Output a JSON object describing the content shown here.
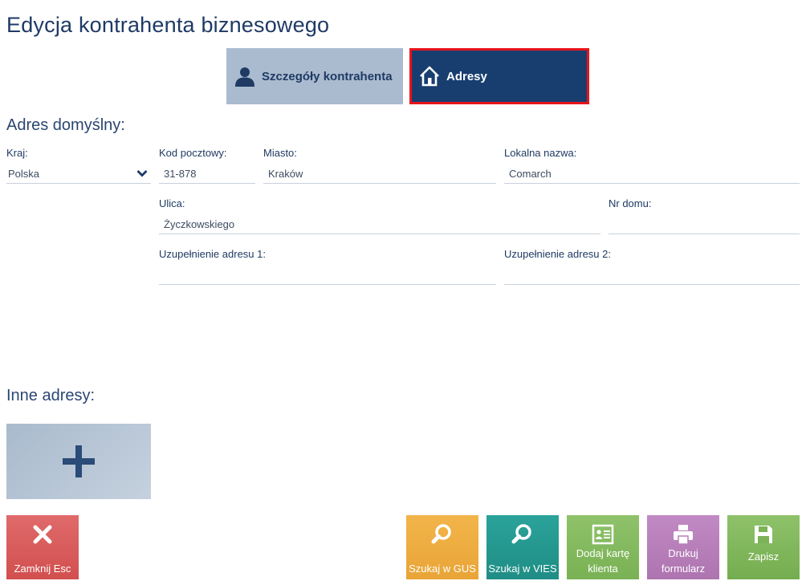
{
  "page": {
    "title": "Edycja kontrahenta biznesowego"
  },
  "tabs": [
    {
      "label": "Szczegóły kontrahenta",
      "icon": "user-icon",
      "active": false
    },
    {
      "label": "Adresy",
      "icon": "home-icon",
      "active": true
    }
  ],
  "default_address": {
    "heading": "Adres domyślny:",
    "country": {
      "label": "Kraj:",
      "value": "Polska"
    },
    "postal_code": {
      "label": "Kod pocztowy:",
      "value": "31-878"
    },
    "city": {
      "label": "Miasto:",
      "value": "Kraków"
    },
    "local_name": {
      "label": "Lokalna nazwa:",
      "value": "Comarch"
    },
    "street": {
      "label": "Ulica:",
      "value": "Życzkowskiego"
    },
    "house_no": {
      "label": "Nr domu:",
      "value": ""
    },
    "address_ext1": {
      "label": "Uzupełnienie adresu 1:",
      "value": ""
    },
    "address_ext2": {
      "label": "Uzupełnienie adresu 2:",
      "value": ""
    }
  },
  "other_addresses": {
    "heading": "Inne adresy:",
    "add_icon": "plus-icon"
  },
  "actions": {
    "close": {
      "label": "Zamknij Esc",
      "icon": "close-icon"
    },
    "search_gus": {
      "label": "Szukaj w GUS",
      "icon": "search-icon"
    },
    "search_vies": {
      "label": "Szukaj w VIES",
      "icon": "search-icon"
    },
    "add_card": {
      "label": "Dodaj kartę klienta",
      "icon": "id-card-icon"
    },
    "print_form": {
      "label": "Drukuj formularz",
      "icon": "printer-icon"
    },
    "save": {
      "label": "Zapisz",
      "icon": "save-icon"
    }
  },
  "colors": {
    "active_tab": "#183e70",
    "inactive_tab": "#aabbd0",
    "highlight_border": "#e8141b",
    "close": "#d95c5c",
    "gus": "#eeae42",
    "vies": "#26998f",
    "green": "#82b85e",
    "print": "#b77fba"
  }
}
